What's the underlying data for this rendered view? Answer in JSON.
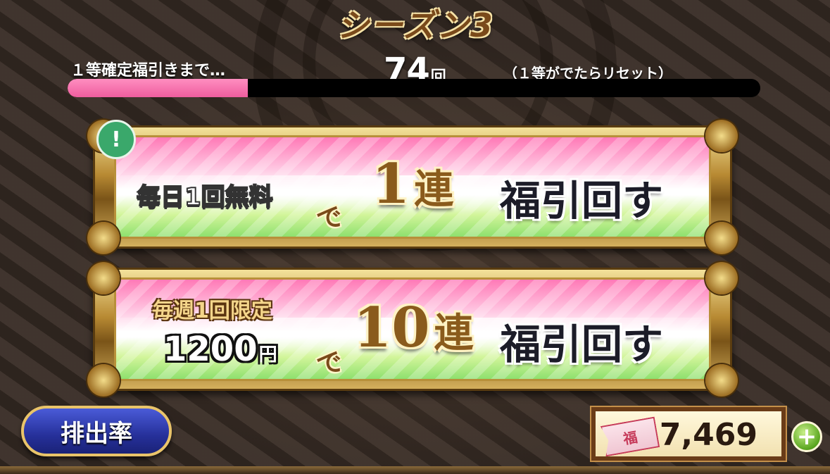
{
  "header": {
    "season_title": "シーズン3"
  },
  "progress": {
    "label": "１等確定福引きまで…",
    "remaining_count": "74",
    "remaining_unit": "回",
    "reset_note": "（１等がでたらリセット）",
    "fill_fraction": 0.26
  },
  "banner_single": {
    "condition": "毎日1回無料",
    "particle": "で",
    "count_number": "1",
    "count_unit": "連",
    "action": "福引回す",
    "badge": "!"
  },
  "banner_ten": {
    "limit": "毎週1回限定",
    "price_number": "1200",
    "price_unit": "円",
    "particle": "で",
    "count_number": "10",
    "count_unit": "連",
    "action": "福引回す"
  },
  "footer": {
    "rates_button": "排出率",
    "ticket_icon_text": "福",
    "ticket_count": "7,469",
    "add_button": "+"
  },
  "colors": {
    "progress_fill": "#ee5d9e",
    "rates_button": "#26309a",
    "badge": "#3aa86b",
    "add_button": "#5aa61f"
  },
  "icons": {
    "alert": "exclamation-badge-icon",
    "ticket": "fuku-ticket-icon",
    "add": "plus-circle-icon"
  }
}
